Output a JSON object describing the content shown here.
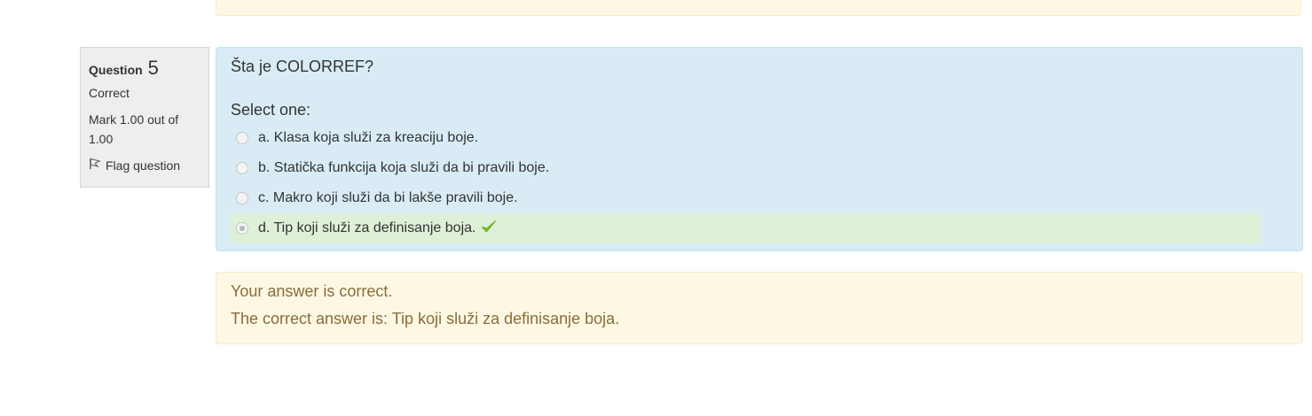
{
  "info": {
    "question_label": "Question",
    "question_number": "5",
    "state": "Correct",
    "grade": "Mark 1.00 out of 1.00",
    "flag_label": "Flag question"
  },
  "question": {
    "text": "Šta je COLORREF?",
    "prompt": "Select one:",
    "answers": [
      {
        "label": "a. Klasa koja služi za kreaciju boje.",
        "selected": false
      },
      {
        "label": "b. Statička funkcija koja služi da bi pravili boje.",
        "selected": false
      },
      {
        "label": "c. Makro koji služi da bi lakše pravili boje.",
        "selected": false
      },
      {
        "label": "d. Tip koji služi za definisanje boja.",
        "selected": true,
        "correct": true
      }
    ]
  },
  "feedback": {
    "result": "Your answer is correct.",
    "right_answer": "The correct answer is: Tip koji služi za definisanje boja."
  },
  "colors": {
    "info_bg": "#eeeeee",
    "question_bg": "#d9ecf5",
    "correct_bg": "#dff0d8",
    "feedback_bg": "#fcf8e3",
    "feedback_text": "#8a6d3b",
    "check": "#7cbf2d"
  }
}
